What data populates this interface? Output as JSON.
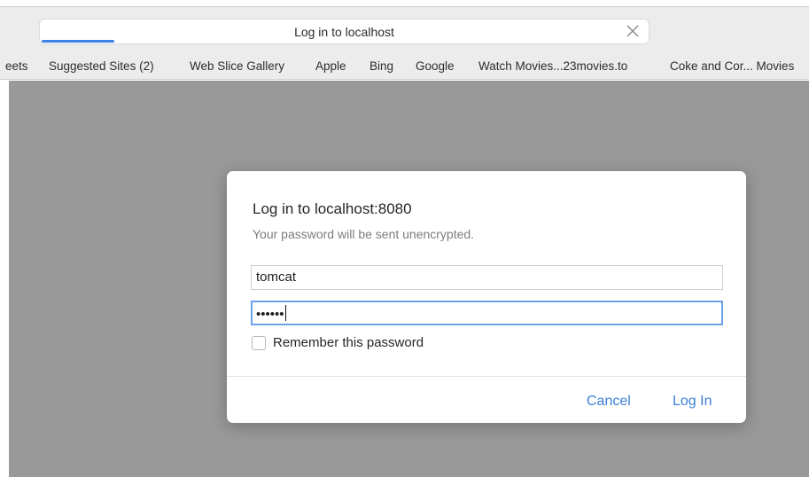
{
  "tab": {
    "title": "Log in to localhost",
    "close_icon": "close-icon",
    "load_progress": 0.12
  },
  "bookmarks": [
    "eets",
    "Suggested Sites (2)",
    "Web Slice Gallery",
    "Apple",
    "Bing",
    "Google",
    "Watch Movies...23movies.to",
    "Coke and Cor... Movies"
  ],
  "dialog": {
    "title": "Log in to localhost:8080",
    "subtitle": "Your password will be sent unencrypted.",
    "username_value": "tomcat",
    "password_value": "••••••",
    "remember_label": "Remember this password",
    "remember_checked": false,
    "cancel_label": "Cancel",
    "login_label": "Log In"
  },
  "colors": {
    "accent": "#3b7fd6",
    "focus_ring": "#6aa2ec",
    "backdrop": "#999999"
  }
}
